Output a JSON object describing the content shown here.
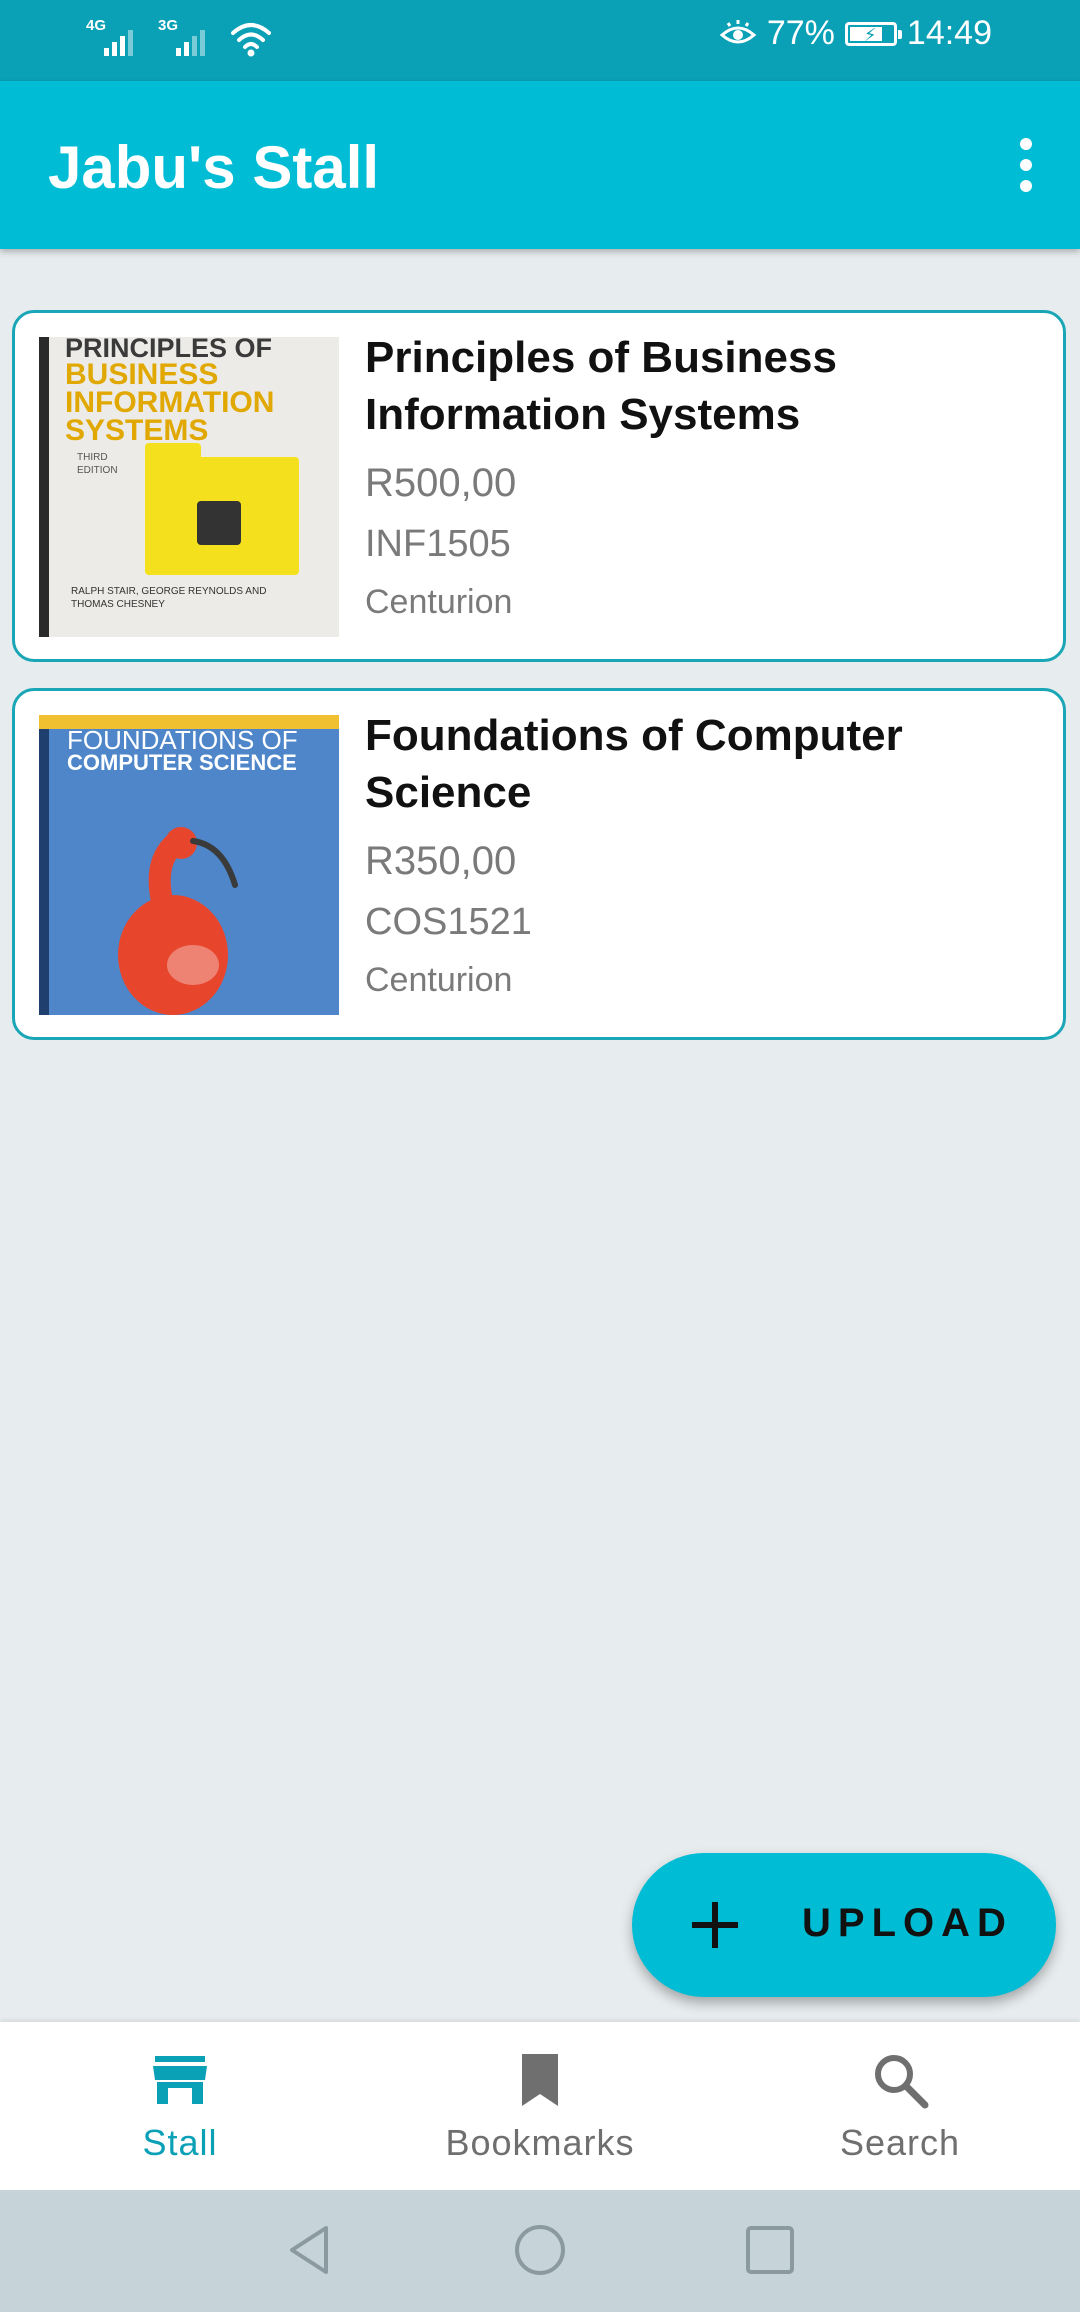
{
  "status_bar": {
    "network1": "4G",
    "network2": "3G",
    "battery_percent": "77%",
    "battery_level": 0.77,
    "time": "14:49",
    "icons": [
      "signal-icon",
      "wifi-icon",
      "eye-comfort-icon",
      "battery-charging-icon"
    ]
  },
  "app_bar": {
    "title": "Jabu's Stall",
    "menu_icon": "more-vert-icon"
  },
  "listings": [
    {
      "title": "Principles of Business Information Systems",
      "price": "R500,00",
      "module_code": "INF1505",
      "location": "Centurion",
      "cover": {
        "line1": "PRINCIPLES OF",
        "line2": "BUSINESS INFORMATION SYSTEMS",
        "edition": "THIRD EDITION",
        "authors": "RALPH STAIR, GEORGE REYNOLDS AND THOMAS CHESNEY"
      }
    },
    {
      "title": "Foundations of Computer Science",
      "price": "R350,00",
      "module_code": "COS1521",
      "location": "Centurion",
      "cover": {
        "line1": "FOUNDATIONS OF",
        "line2": "COMPUTER SCIENCE"
      }
    }
  ],
  "fab": {
    "label": "UPLOAD",
    "icon": "plus-icon"
  },
  "bottom_nav": [
    {
      "label": "Stall",
      "icon": "store-icon",
      "active": true
    },
    {
      "label": "Bookmarks",
      "icon": "bookmark-icon",
      "active": false
    },
    {
      "label": "Search",
      "icon": "search-icon",
      "active": false
    }
  ],
  "colors": {
    "primary": "#00bcd4",
    "status_bar": "#0aa0b6",
    "active_nav": "#0aa0b6",
    "background": "#e7ecee"
  }
}
